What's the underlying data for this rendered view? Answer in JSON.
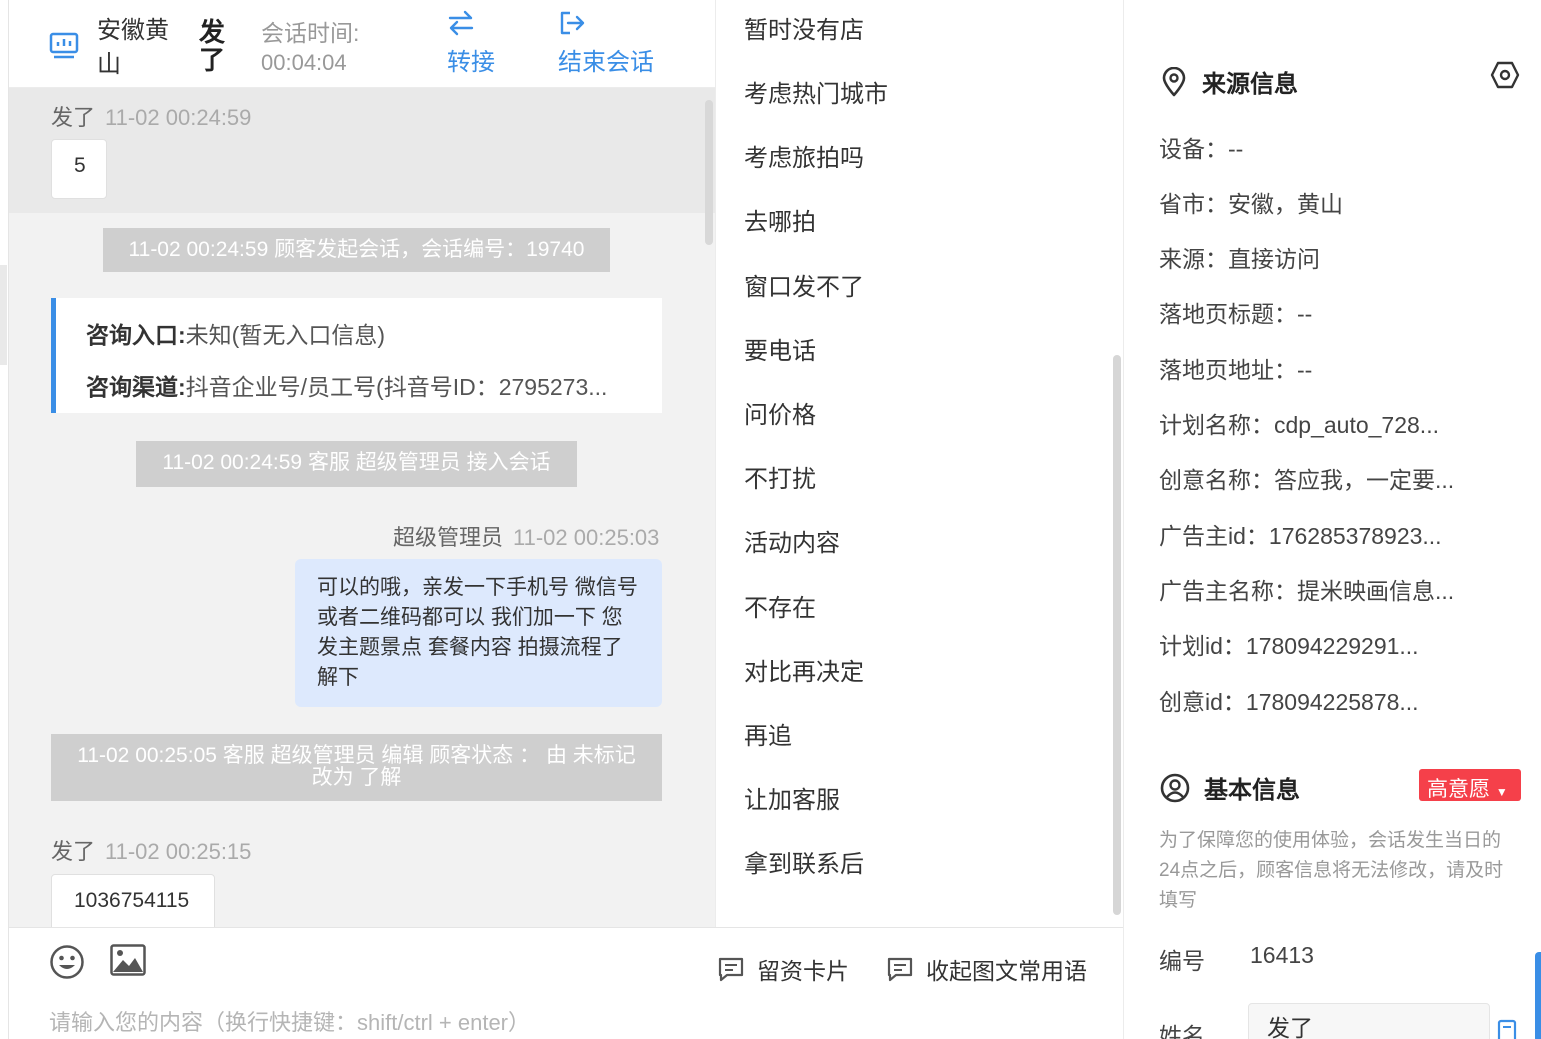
{
  "header": {
    "customer_name": "安徽黄山",
    "customer_nick": "发了",
    "session_time_label": "会话时间:",
    "session_time": "00:04:04",
    "transfer_label": "转接",
    "end_label": "结束会话"
  },
  "chat": {
    "msg1": {
      "sender": "发了",
      "time": "11-02 00:24:59",
      "text": "5"
    },
    "sys1": "11-02 00:24:59 顾客发起会话，会话编号：19740",
    "info_card": {
      "entry_label": "咨询入口:",
      "entry_value": "未知(暂无入口信息)",
      "channel_label": "咨询渠道:",
      "channel_value": "抖音企业号/员工号(抖音号ID：2795273..."
    },
    "sys2": "11-02 00:24:59 客服 超级管理员 接入会话",
    "msg2": {
      "sender": "超级管理员",
      "time": "11-02 00:25:03",
      "text": "可以的哦，亲发一下手机号 微信号或者二维码都可以 我们加一下 您发主题景点 套餐内容 拍摄流程了解下"
    },
    "sys3": "11-02 00:25:05 客服 超级管理员 编辑 顾客状态 ： 由 未标记 改为 了解",
    "msg3": {
      "sender": "发了",
      "time": "11-02 00:25:15",
      "text": "1036754115"
    }
  },
  "phrases": [
    "暂时没有店",
    "考虑热门城市",
    "考虑旅拍吗",
    "去哪拍",
    "窗口发不了",
    "要电话",
    "问价格",
    "不打扰",
    "活动内容",
    "不存在",
    "对比再决定",
    "再追",
    "让加客服",
    "拿到联系后"
  ],
  "composer": {
    "card_label": "留资卡片",
    "collapse_label": "收起图文常用语",
    "placeholder": "请输入您的内容（换行快捷键：shift/ctrl + enter）"
  },
  "source": {
    "title": "来源信息",
    "device": "设备：--",
    "province": "省市：安徽，黄山",
    "origin": "来源：直接访问",
    "landing_title": "落地页标题：--",
    "landing_url": "落地页地址：--",
    "plan_name": "计划名称：cdp_auto_728...",
    "creative_name": "创意名称：答应我，一定要...",
    "advertiser_id": "广告主id：176285378923...",
    "advertiser_name": "广告主名称：提米映画信息...",
    "plan_id": "计划id：178094229291...",
    "creative_id": "创意id：178094225878..."
  },
  "basic": {
    "title": "基本信息",
    "intent_badge": "高意愿",
    "notice": "为了保障您的使用体验，会话发生当日的24点之后，顾客信息将无法修改，请及时填写",
    "number_label": "编号",
    "number_value": "16413",
    "name_label": "姓名",
    "name_value": "发了"
  },
  "colors": {
    "accent": "#3a8ee6",
    "badge": "#f5404a",
    "outgoing_bubble": "#dde9fd"
  }
}
